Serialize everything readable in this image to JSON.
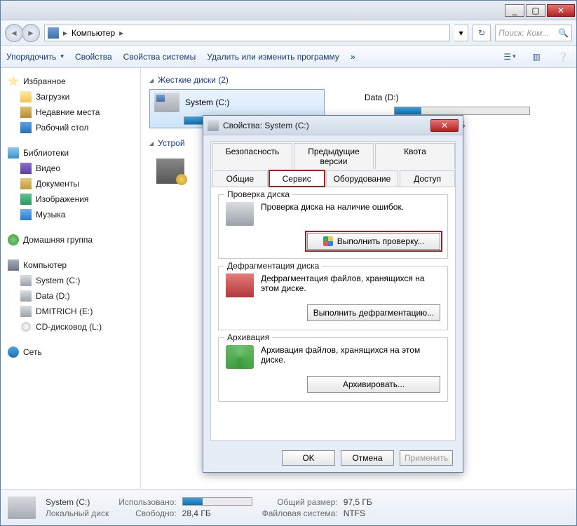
{
  "titlebar": {
    "min": "_",
    "max": "▢",
    "close": "✕"
  },
  "breadcrumb": {
    "root": "Компьютер",
    "sep": "▸"
  },
  "search": {
    "placeholder": "Поиск: Ком..."
  },
  "toolbar": {
    "organize": "Упорядочить",
    "properties": "Свойства",
    "system_properties": "Свойства системы",
    "uninstall": "Удалить или изменить программу",
    "more": "»"
  },
  "sidebar": {
    "favorites": "Избранное",
    "downloads": "Загрузки",
    "recent": "Недавние места",
    "desktop": "Рабочий стол",
    "libraries": "Библиотеки",
    "video": "Видео",
    "documents": "Документы",
    "pictures": "Изображения",
    "music": "Музыка",
    "homegroup": "Домашняя группа",
    "computer": "Компьютер",
    "c": "System (C:)",
    "d": "Data (D:)",
    "e": "DMITRICH (E:)",
    "l": "CD-дисковод (L:)",
    "network": "Сеть"
  },
  "main": {
    "hdd_header": "Жесткие диски (2)",
    "dev_header": "Устрой",
    "drive_c": "System (C:)",
    "drive_d": "Data (D:)",
    "d_size_tail": "ГБ",
    "c_fill_pct": 29
  },
  "dialog": {
    "title": "Свойства: System (C:)",
    "tabs_row1": {
      "security": "Безопасность",
      "prev": "Предыдущие версии",
      "quota": "Квота"
    },
    "tabs_row2": {
      "general": "Общие",
      "tools": "Сервис",
      "hardware": "Оборудование",
      "sharing": "Доступ"
    },
    "check": {
      "legend": "Проверка диска",
      "text": "Проверка диска на наличие ошибок.",
      "button": "Выполнить проверку..."
    },
    "defrag": {
      "legend": "Дефрагментация диска",
      "text": "Дефрагментация файлов, хранящихся на этом диске.",
      "button": "Выполнить дефрагментацию..."
    },
    "backup": {
      "legend": "Архивация",
      "text": "Архивация файлов, хранящихся на этом диске.",
      "button": "Архивировать..."
    },
    "ok": "OK",
    "cancel": "Отмена",
    "apply": "Применить"
  },
  "status": {
    "name": "System (C:)",
    "type": "Локальный диск",
    "used_label": "Использовано:",
    "free_label": "Свободно:",
    "free_value": "28,4 ГБ",
    "total_label": "Общий размер:",
    "total_value": "97,5 ГБ",
    "fs_label": "Файловая система:",
    "fs_value": "NTFS"
  }
}
